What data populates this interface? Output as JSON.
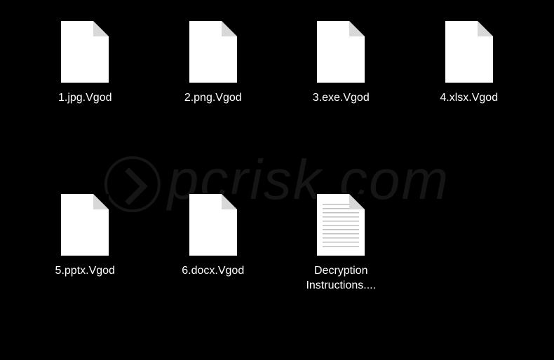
{
  "files": [
    {
      "name": "1.jpg.Vgod",
      "type": "blank"
    },
    {
      "name": "2.png.Vgod",
      "type": "blank"
    },
    {
      "name": "3.exe.Vgod",
      "type": "blank"
    },
    {
      "name": "4.xlsx.Vgod",
      "type": "blank"
    },
    {
      "name": "5.pptx.Vgod",
      "type": "blank"
    },
    {
      "name": "6.docx.Vgod",
      "type": "blank"
    },
    {
      "name": "Decryption Instructions....",
      "type": "text"
    }
  ],
  "watermark": "pcrisk.com"
}
